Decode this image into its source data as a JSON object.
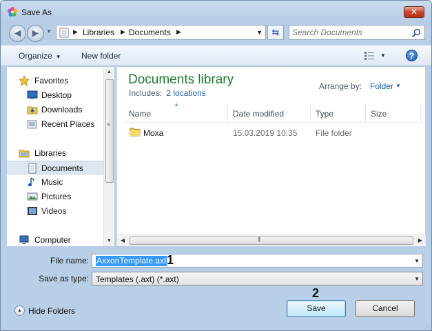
{
  "window": {
    "title": "Save As",
    "close_label": "✕"
  },
  "address": {
    "crumbs": [
      "Libraries",
      "Documents"
    ],
    "search_placeholder": "Search Documents"
  },
  "toolbar": {
    "organize_label": "Organize",
    "new_folder_label": "New folder",
    "help_label": "?"
  },
  "nav": {
    "items": [
      {
        "label": "Favorites",
        "icon": "star-icon"
      },
      {
        "label": "Desktop",
        "icon": "desktop-icon"
      },
      {
        "label": "Downloads",
        "icon": "downloads-icon"
      },
      {
        "label": "Recent Places",
        "icon": "recent-places-icon"
      },
      {
        "label": "Libraries",
        "icon": "libraries-icon"
      },
      {
        "label": "Documents",
        "icon": "documents-icon",
        "selected": true
      },
      {
        "label": "Music",
        "icon": "music-icon"
      },
      {
        "label": "Pictures",
        "icon": "pictures-icon"
      },
      {
        "label": "Videos",
        "icon": "videos-icon"
      },
      {
        "label": "Computer",
        "icon": "computer-icon"
      }
    ]
  },
  "content": {
    "library_title": "Documents library",
    "includes_label": "Includes:",
    "includes_link": "2 locations",
    "arrange_label": "Arrange by:",
    "arrange_value": "Folder",
    "columns": [
      "Name",
      "Date modified",
      "Type",
      "Size"
    ],
    "rows": [
      {
        "name": "Moxa",
        "date": "15.03.2019 10:35",
        "type": "File folder",
        "size": ""
      }
    ]
  },
  "form": {
    "filename_label": "File name:",
    "filename_value": "AxxonTemplate.axt",
    "savetype_label": "Save as type:",
    "savetype_value": "Templates (.axt) (*.axt)",
    "annotation_1": "1",
    "annotation_2": "2"
  },
  "footer": {
    "hide_folders_label": "Hide Folders",
    "save_label": "Save",
    "cancel_label": "Cancel"
  },
  "colors": {
    "library_title": "#1d7b2a",
    "link": "#1b5fb3",
    "selection": "#3399ff"
  }
}
